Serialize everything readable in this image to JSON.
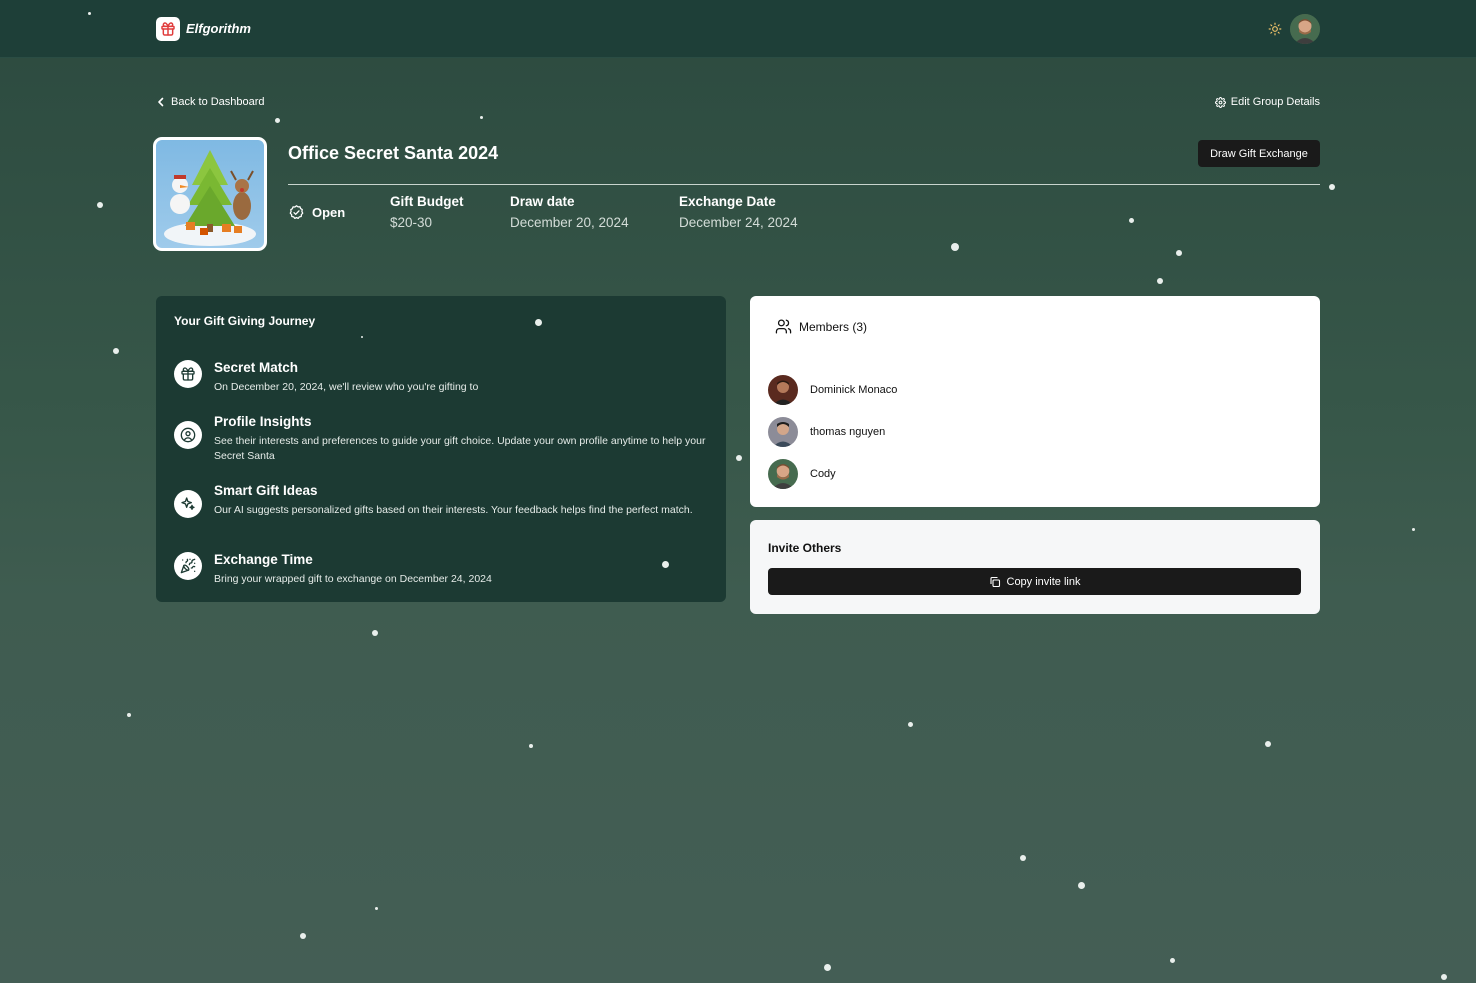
{
  "app": {
    "name": "Elfgorithm"
  },
  "nav": {
    "back_label": "Back to Dashboard",
    "edit_label": "Edit Group Details"
  },
  "group": {
    "title": "Office Secret Santa 2024",
    "draw_button": "Draw Gift Exchange",
    "status": "Open",
    "meta": [
      {
        "label": "Gift Budget",
        "value": "$20-30"
      },
      {
        "label": "Draw date",
        "value": "December 20, 2024"
      },
      {
        "label": "Exchange Date",
        "value": "December 24, 2024"
      }
    ]
  },
  "journey": {
    "title": "Your Gift Giving Journey",
    "steps": [
      {
        "title": "Secret Match",
        "desc": "On December 20, 2024, we'll review who you're gifting to",
        "icon": "gift-icon"
      },
      {
        "title": "Profile Insights",
        "desc": "See their interests and preferences to guide your gift choice. Update your own profile anytime to help your Secret Santa",
        "icon": "user-circle-icon"
      },
      {
        "title": "Smart Gift Ideas",
        "desc": "Our AI suggests personalized gifts based on their interests. Your feedback helps find the perfect match.",
        "icon": "sparkles-icon"
      },
      {
        "title": "Exchange Time",
        "desc": "Bring your wrapped gift to exchange on December 24, 2024",
        "icon": "party-popper-icon"
      }
    ]
  },
  "members": {
    "title": "Members (3)",
    "list": [
      {
        "name": "Dominick Monaco"
      },
      {
        "name": "thomas nguyen"
      },
      {
        "name": "Cody"
      }
    ]
  },
  "invite": {
    "title": "Invite Others",
    "button": "Copy invite link"
  },
  "colors": {
    "header_bg": "#1e3f38",
    "page_bg": "#375749",
    "card_dark": "#1c3a33",
    "button_dark": "#1a1a1a"
  }
}
